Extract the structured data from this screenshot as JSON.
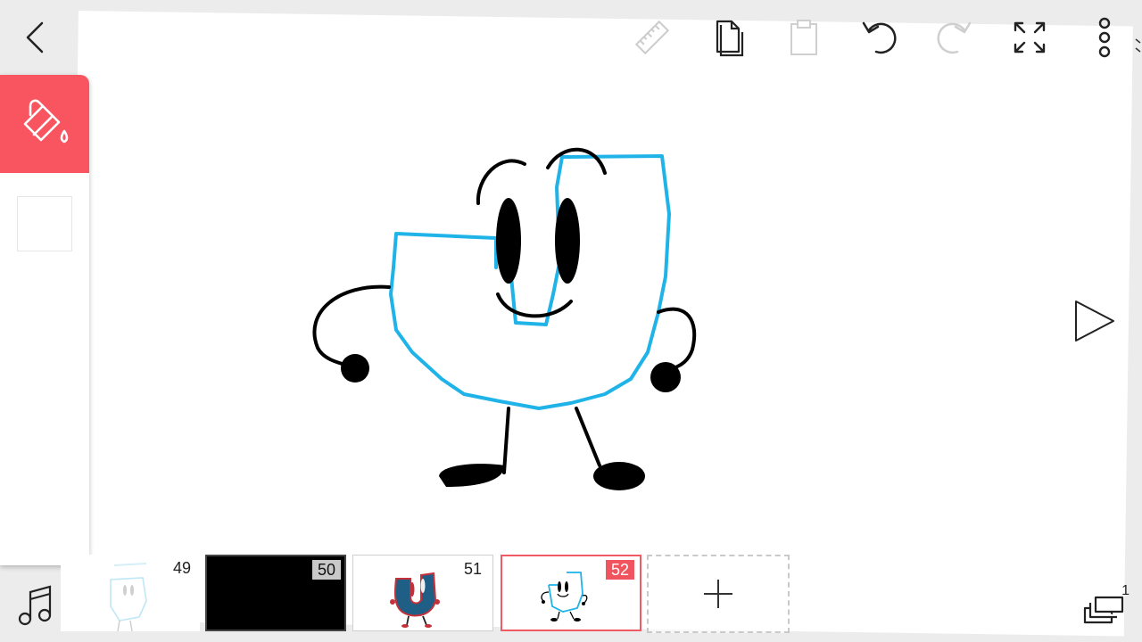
{
  "toolbar": {
    "icons": [
      "back-arrow-icon",
      "ruler-icon",
      "copy-icon",
      "paste-icon",
      "undo-icon",
      "redo-icon",
      "fullscreen-icon",
      "more-vertical-icon"
    ]
  },
  "left_panel": {
    "active_tool": "paint-bucket-icon",
    "accent": "#f85560",
    "current_color": "#ffffff"
  },
  "frames": [
    {
      "number": "49",
      "selected": false
    },
    {
      "number": "50",
      "selected": false
    },
    {
      "number": "51",
      "selected": false
    },
    {
      "number": "52",
      "selected": true
    }
  ],
  "layers": {
    "count": "1"
  },
  "colors": {
    "outline_blue": "#1fb3e8",
    "ink": "#000000",
    "accent_red": "#f0545f"
  }
}
